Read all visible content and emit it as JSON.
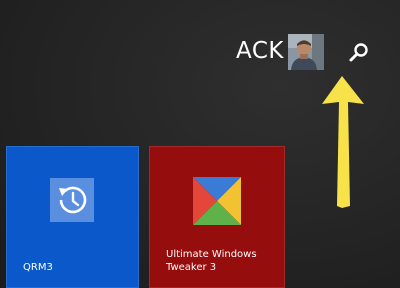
{
  "user": {
    "name": "ACK"
  },
  "icons": {
    "avatar": "user-photo",
    "search": "search-icon",
    "annotation": "arrow-up-icon",
    "qrm": "restore-clock-icon",
    "uwt": "four-color-pinwheel-icon"
  },
  "tiles": [
    {
      "label": "QRM3",
      "color": "#0a58c9"
    },
    {
      "label": "Ultimate Windows Tweaker 3",
      "color": "#950d0d"
    }
  ],
  "colors": {
    "background": "#242424",
    "annotation_arrow": "#f7e24a"
  }
}
